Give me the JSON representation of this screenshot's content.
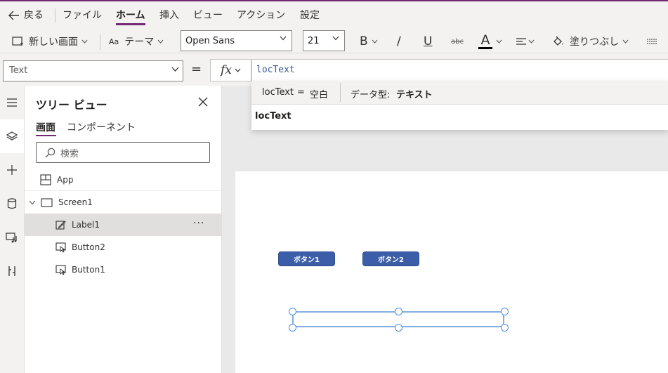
{
  "menubar": {
    "back": "戻る",
    "items": [
      "ファイル",
      "ホーム",
      "挿入",
      "ビュー",
      "アクション",
      "設定"
    ]
  },
  "ribbon": {
    "new_screen": "新しい画面",
    "theme": "テーマ",
    "font": "Open Sans",
    "font_size": "21",
    "bold": "B",
    "italic": "/",
    "underline": "U",
    "strike": "abc",
    "font_color": "A",
    "fill": "塗りつぶし"
  },
  "formula_bar": {
    "property": "Text",
    "equals": "=",
    "fx": "fx",
    "formula": "locText"
  },
  "intellisense": {
    "result_name": "locText",
    "result_eq": "=",
    "result_value": "空白",
    "data_type_label": "データ型:",
    "data_type_value": "テキスト",
    "suggestion": "locText"
  },
  "tree_view": {
    "title": "ツリー ビュー",
    "tabs": [
      "画面",
      "コンポーネント"
    ],
    "search_placeholder": "検索",
    "items": [
      {
        "name": "App",
        "icon": "app-icon"
      },
      {
        "name": "Screen1",
        "icon": "screen-icon"
      },
      {
        "name": "Label1",
        "icon": "label-edit-icon",
        "selected": true
      },
      {
        "name": "Button2",
        "icon": "button-icon"
      },
      {
        "name": "Button1",
        "icon": "button-icon"
      }
    ],
    "more": "···"
  },
  "canvas": {
    "button1": "ボタン1",
    "button2": "ボタン2"
  },
  "colors": {
    "accent": "#742774",
    "button": "#3c5ea8",
    "selection": "#4a90e2"
  }
}
